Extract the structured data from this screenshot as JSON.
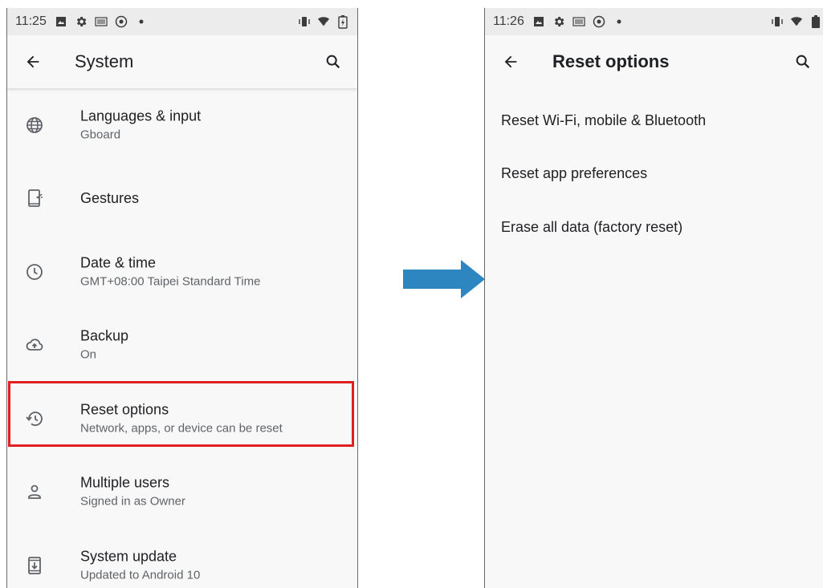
{
  "left_screen": {
    "status_time": "11:25",
    "title": "System",
    "items": [
      {
        "title": "Languages & input",
        "subtitle": "Gboard",
        "icon": "globe-icon"
      },
      {
        "title": "Gestures",
        "subtitle": "",
        "icon": "gestures-icon"
      },
      {
        "title": "Date & time",
        "subtitle": "GMT+08:00 Taipei Standard Time",
        "icon": "clock-icon"
      },
      {
        "title": "Backup",
        "subtitle": "On",
        "icon": "cloud-upload-icon"
      },
      {
        "title": "Reset options",
        "subtitle": "Network, apps, or device can be reset",
        "icon": "history-icon"
      },
      {
        "title": "Multiple users",
        "subtitle": "Signed in as Owner",
        "icon": "person-icon"
      },
      {
        "title": "System update",
        "subtitle": "Updated to Android 10",
        "icon": "system-update-icon"
      }
    ],
    "highlight_color": "#e02020"
  },
  "right_screen": {
    "status_time": "11:26",
    "title": "Reset options",
    "items": [
      {
        "title": "Reset Wi-Fi, mobile & Bluetooth"
      },
      {
        "title": "Reset app preferences"
      },
      {
        "title": "Erase all data (factory reset)"
      }
    ]
  },
  "arrow_color": "#2e86c1"
}
